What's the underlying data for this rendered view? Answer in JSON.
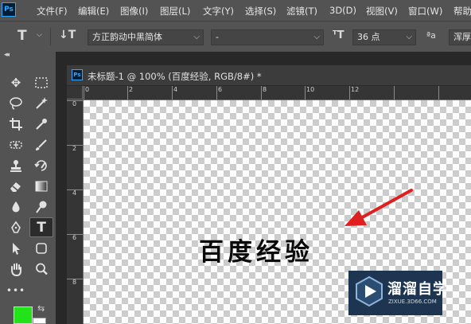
{
  "menubar": {
    "logo": "Ps",
    "items": [
      "文件(F)",
      "编辑(E)",
      "图像(I)",
      "图层(L)",
      "文字(Y)",
      "选择(S)",
      "滤镜(T)",
      "3D(D)",
      "视图(V)",
      "窗口(W)",
      "帮助"
    ]
  },
  "options": {
    "font_family": "方正韵动中黑简体",
    "font_style": "-",
    "font_size": "36 点",
    "aa_label": "ªa",
    "aa_value": "浑厚"
  },
  "toolbar": {
    "collapse": "◂◂",
    "foreground_color": "#22e218",
    "background_color": "#ffffff"
  },
  "document": {
    "icon": "Ps",
    "title": "未标题-1 @ 100% (百度经验, RGB/8#) *",
    "ruler_top": [
      "0",
      "2",
      "4",
      "6",
      "8",
      "10",
      "12"
    ],
    "ruler_left": [
      "0",
      "2",
      "4",
      "6",
      "8"
    ],
    "canvas_text": "百度经验",
    "arrow_color": "#e02020"
  },
  "watermark": {
    "title": "溜溜自学",
    "url": "ZIXUE.3D66.COM"
  }
}
